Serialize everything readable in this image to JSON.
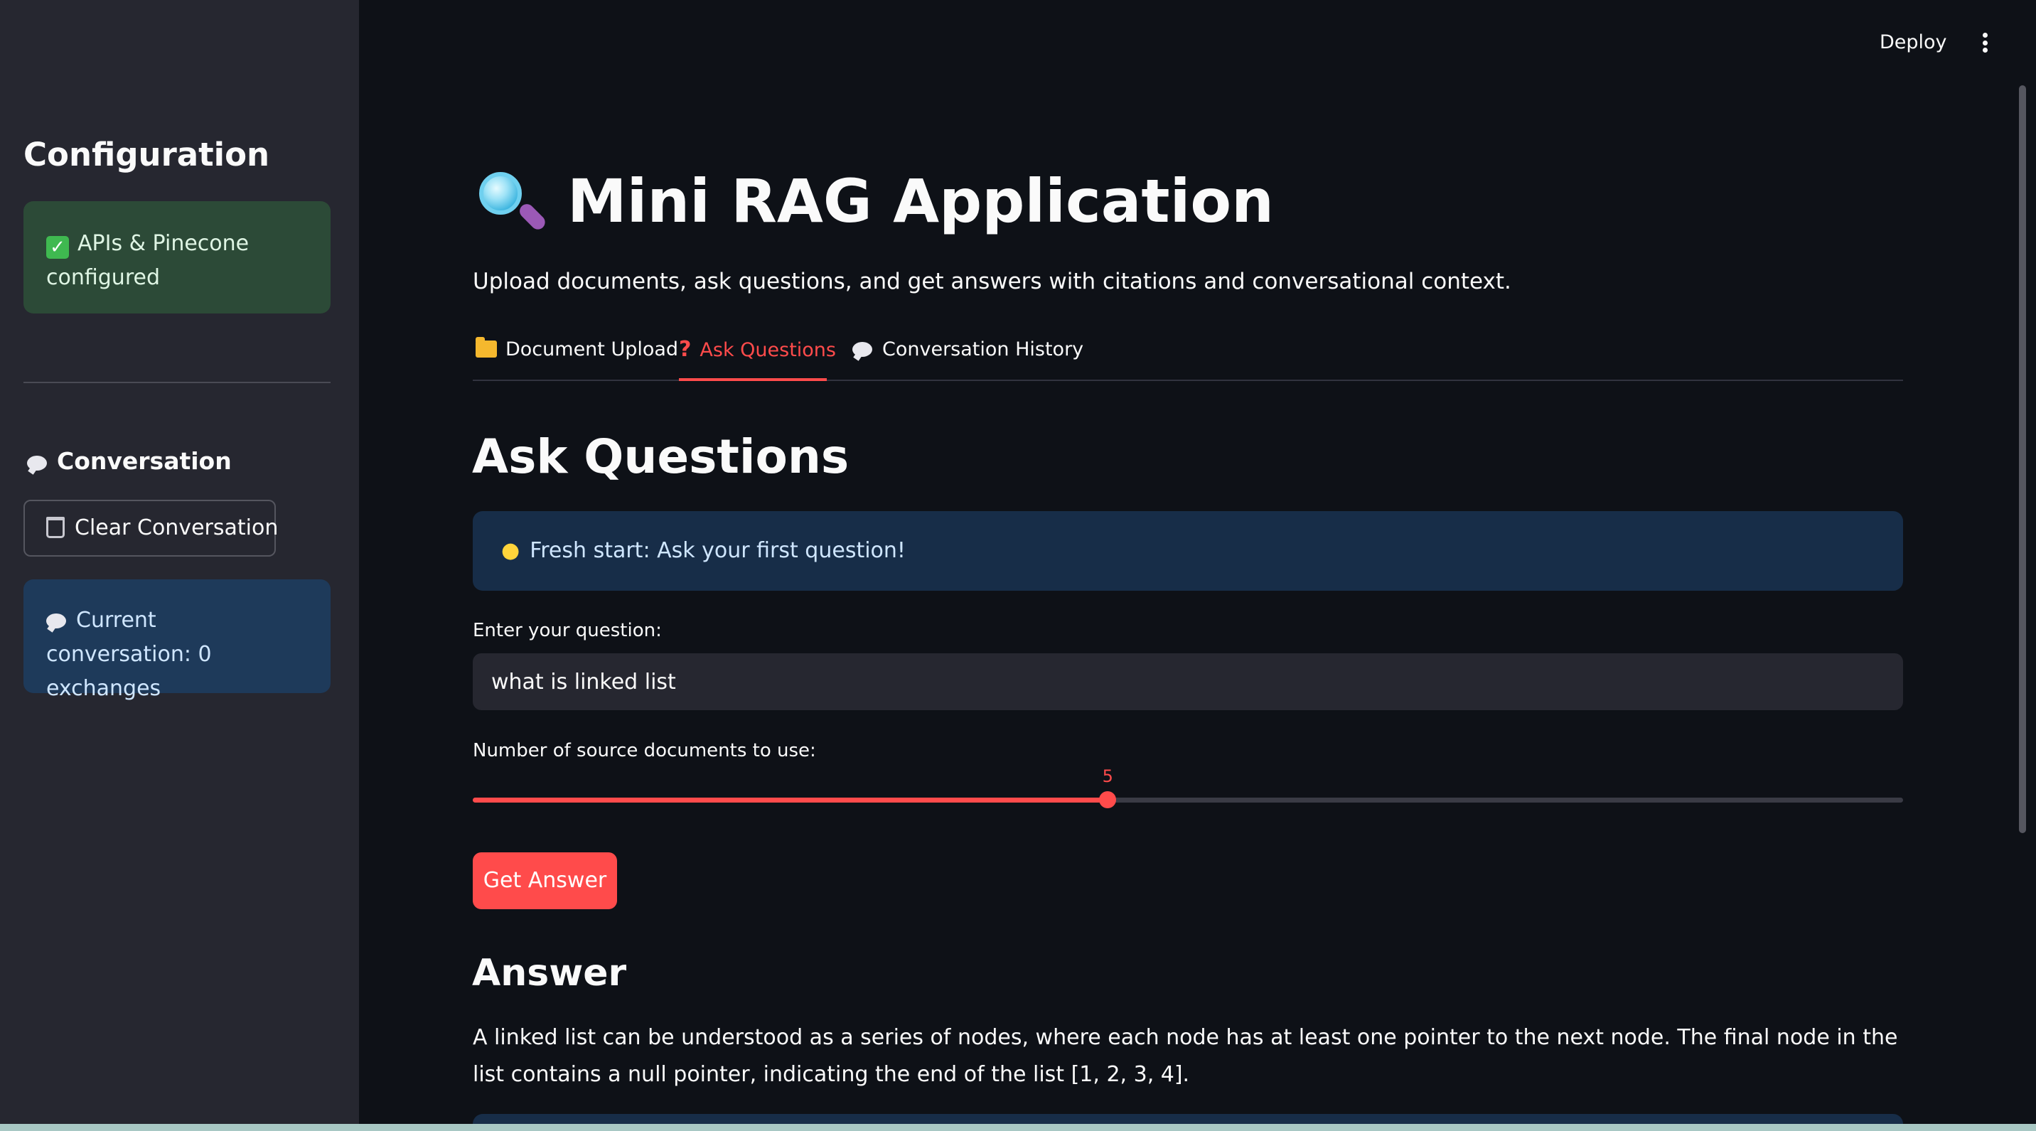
{
  "header": {
    "deploy_label": "Deploy",
    "menu_icon": "kebab-menu-icon"
  },
  "sidebar": {
    "title": "Configuration",
    "status": {
      "icon": "check-mark-icon",
      "text": "APIs & Pinecone configured",
      "color": "#2c4a37"
    },
    "conversation_title": "Conversation",
    "clear_button_label": "Clear Conversation",
    "info": {
      "text": "Current conversation: 0 exchanges"
    }
  },
  "main": {
    "title": "Mini RAG Application",
    "subtitle": "Upload documents, ask questions, and get answers with citations and conversational context.",
    "tabs": [
      {
        "label": "Document Upload",
        "icon": "folder-icon",
        "active": false
      },
      {
        "label": "Ask Questions",
        "icon": "question-icon",
        "active": true
      },
      {
        "label": "Conversation History",
        "icon": "speech-bubble-icon",
        "active": false
      }
    ],
    "section_title": "Ask Questions",
    "info_text": "Fresh start: Ask your first question!",
    "question_label": "Enter your question:",
    "question_value": "what is linked list",
    "slider": {
      "label": "Number of source documents to use:",
      "value": 5,
      "value_text": "5",
      "fraction": 0.444
    },
    "get_answer_label": "Get Answer",
    "answer_title": "Answer",
    "answer_text": "A linked list can be understood as a series of nodes, where each node has at least one pointer to the next node. The final node in the list contains a null pointer, indicating the end of the list [1, 2, 3, 4]."
  },
  "colors": {
    "accent": "#ff4b4b",
    "background": "#0e1117",
    "sidebar": "#262730",
    "info": "#172d48"
  }
}
